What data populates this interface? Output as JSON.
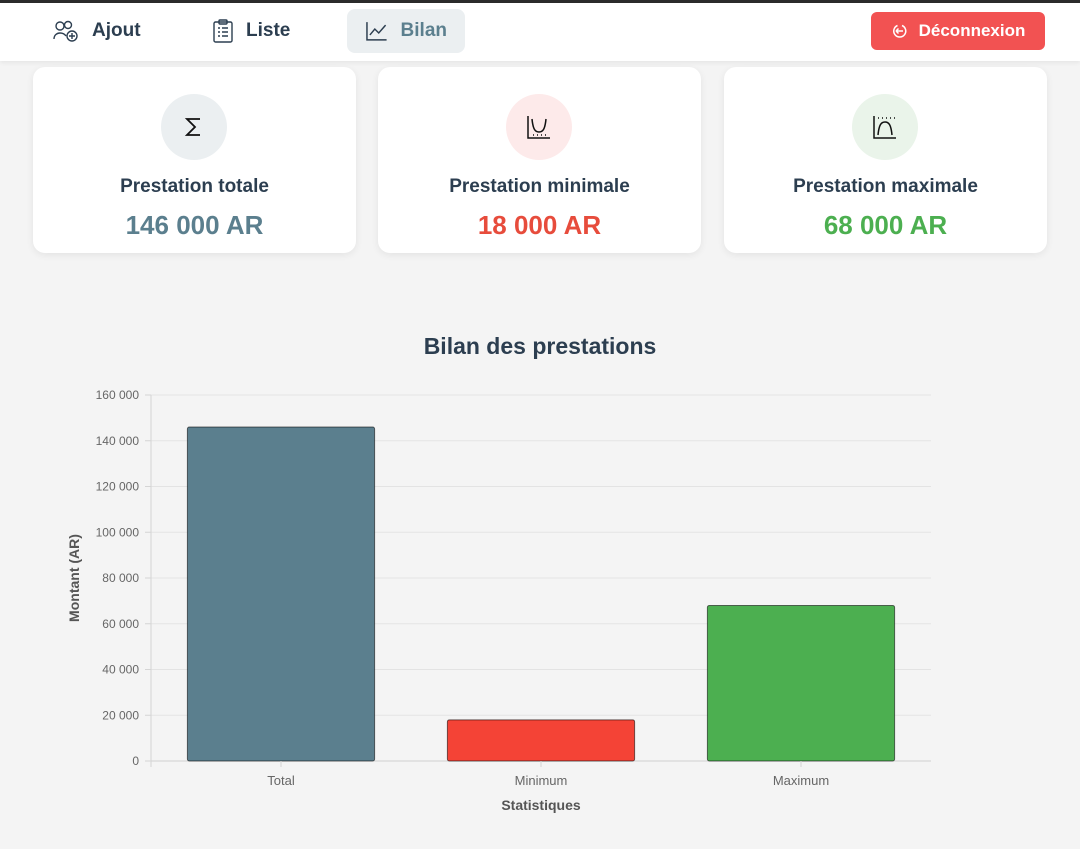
{
  "nav": {
    "items": [
      {
        "label": "Ajout",
        "icon": "users-add-icon"
      },
      {
        "label": "Liste",
        "icon": "clipboard-list-icon"
      },
      {
        "label": "Bilan",
        "icon": "chart-line-icon",
        "active": true
      }
    ],
    "logout_label": "Déconnexion",
    "logout_icon": "logout-icon"
  },
  "cards": [
    {
      "title": "Prestation totale",
      "value": "146 000 AR",
      "icon": "sigma-icon",
      "color": "#5b7f8e",
      "icon_bg": "#ebeff1"
    },
    {
      "title": "Prestation minimale",
      "value": "18 000 AR",
      "icon": "chart-min-icon",
      "color": "#e74c3c",
      "icon_bg": "#fdeaea"
    },
    {
      "title": "Prestation maximale",
      "value": "68 000 AR",
      "icon": "chart-max-icon",
      "color": "#4caf50",
      "icon_bg": "#eaf4ea"
    }
  ],
  "chart_data": {
    "type": "bar",
    "title": "Bilan des prestations",
    "categories": [
      "Total",
      "Minimum",
      "Maximum"
    ],
    "values": [
      146000,
      18000,
      68000
    ],
    "colors": [
      "#5b7f8e",
      "#f44336",
      "#4caf50"
    ],
    "xlabel": "Statistiques",
    "ylabel": "Montant (AR)",
    "ylim": [
      0,
      160000
    ],
    "yticks": [
      0,
      20000,
      40000,
      60000,
      80000,
      100000,
      120000,
      140000,
      160000
    ],
    "ytick_labels": [
      "0",
      "20 000",
      "40 000",
      "60 000",
      "80 000",
      "100 000",
      "120 000",
      "140 000",
      "160 000"
    ],
    "grid": true,
    "legend": "none"
  }
}
